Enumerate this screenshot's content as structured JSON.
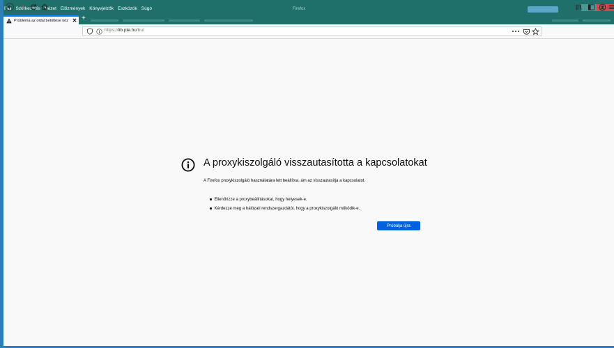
{
  "menubar": [
    "Fájl",
    "Szerkesztés",
    "Nézet",
    "Előzmények",
    "Könyvjelzők",
    "Eszközök",
    "Súgó"
  ],
  "window_title": "Firefox",
  "tab": {
    "label": "Probléma az oldal betöltése köz",
    "close": "✕"
  },
  "newtab": "+",
  "url": {
    "prefix": "https://",
    "domain": "lib.pte.hu",
    "path": "/hu/"
  },
  "error": {
    "title": "A proxykiszolgáló visszautasította a kapcsolatokat",
    "description": "A Firefox proxykiszolgáló használatára lett beállítva, ám az visszautasítja a kapcsolatot.",
    "suggestions": [
      "Ellenőrizze a proxybeállításokat, hogy helyesek-e.",
      "Kérdezze meg a hálózati rendszergazdától, hogy a proxykiszolgáló működik-e."
    ],
    "retry_label": "Próbálja újra"
  },
  "colors": {
    "accent": "#0060df",
    "tab_indicator": "#0a84ff",
    "window_frame": "#1f6f6a"
  },
  "icons": [
    "warning-icon",
    "back-icon",
    "forward-icon",
    "reload-icon",
    "home-icon",
    "shield-icon",
    "info-icon",
    "page-actions-icon",
    "pocket-icon",
    "bookmark-star-icon",
    "library-icon",
    "sidebar-icon",
    "account-icon",
    "menu-icon"
  ]
}
